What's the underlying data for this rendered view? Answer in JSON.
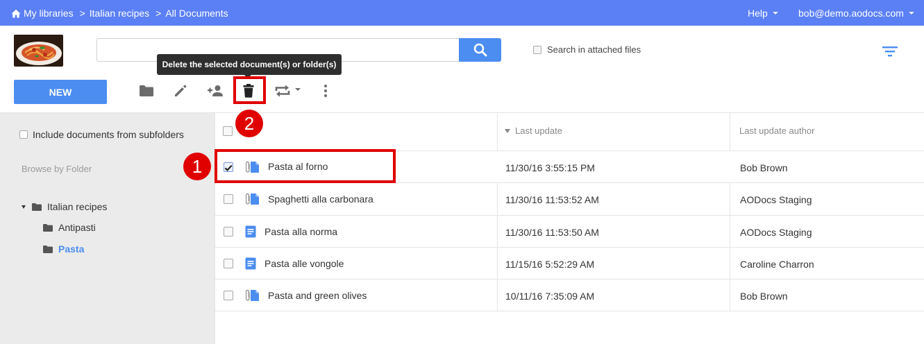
{
  "breadcrumb": {
    "home_label": "My libraries",
    "library": "Italian recipes",
    "view": "All Documents",
    "separator": ">"
  },
  "topbar": {
    "help_label": "Help",
    "user_email": "bob@demo.aodocs.com"
  },
  "search": {
    "placeholder": "",
    "value": "",
    "attached_files_label": "Search in attached files",
    "attached_files_checked": false
  },
  "toolbar": {
    "new_label": "NEW",
    "icons": [
      "folder-icon",
      "edit-icon",
      "add-person-icon",
      "delete-icon",
      "move-icon",
      "more-icon"
    ],
    "tooltip": "Delete the selected document(s) or folder(s)"
  },
  "annotations": {
    "marker_1": "1",
    "marker_2": "2",
    "color": "#e00000"
  },
  "sidebar": {
    "include_subfolders_label": "Include documents from subfolders",
    "browse_label": "Browse by Folder",
    "tree": {
      "root": "Italian recipes",
      "children": [
        "Antipasti",
        "Pasta"
      ],
      "selected": "Pasta"
    }
  },
  "table": {
    "columns": {
      "last_update": "Last update",
      "last_update_author": "Last update author"
    },
    "rows": [
      {
        "name": "Pasta al forno",
        "updated": "11/30/16 3:55:15 PM",
        "author": "Bob Brown",
        "type": "doc-with-attachment",
        "checked": true
      },
      {
        "name": "Spaghetti alla carbonara",
        "updated": "11/30/16 11:53:52 AM",
        "author": "AODocs Staging",
        "type": "doc-with-attachment",
        "checked": false
      },
      {
        "name": "Pasta alla norma",
        "updated": "11/30/16 11:53:50 AM",
        "author": "AODocs Staging",
        "type": "google-doc",
        "checked": false
      },
      {
        "name": "Pasta alle vongole",
        "updated": "11/15/16 5:52:29 AM",
        "author": "Caroline Charron",
        "type": "google-doc",
        "checked": false
      },
      {
        "name": "Pasta and green olives",
        "updated": "10/11/16 7:35:09 AM",
        "author": "Bob Brown",
        "type": "doc-with-attachment",
        "checked": false
      }
    ]
  },
  "colors": {
    "topbar": "#5b7ff5",
    "primary_button": "#4b8df0",
    "sidebar": "#ebebeb",
    "active_folder": "#4b8df0"
  }
}
